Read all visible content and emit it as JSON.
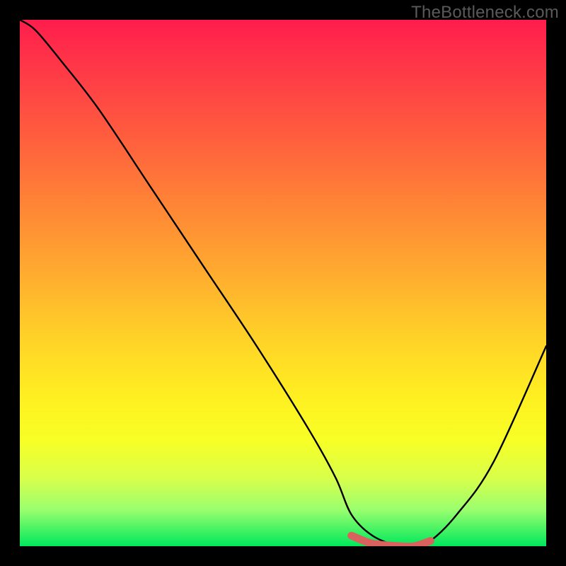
{
  "watermark": "TheBottleneck.com",
  "chart_data": {
    "type": "line",
    "title": "",
    "xlabel": "",
    "ylabel": "",
    "xlim": [
      0,
      100
    ],
    "ylim": [
      0,
      100
    ],
    "series": [
      {
        "name": "bottleneck-curve",
        "x": [
          0,
          3,
          8,
          15,
          25,
          35,
          45,
          55,
          60,
          63,
          67,
          72,
          75,
          78,
          83,
          90,
          100
        ],
        "y": [
          100,
          98,
          92,
          83,
          68,
          53,
          38,
          22,
          13,
          6,
          2,
          0,
          0,
          1,
          6,
          16,
          38
        ],
        "color": "#000000"
      },
      {
        "name": "optimal-range-marker",
        "x": [
          63,
          67,
          72,
          75,
          78
        ],
        "y": [
          2,
          0.5,
          0,
          0,
          1
        ],
        "color": "#d9625f"
      }
    ],
    "gradient_stops": [
      {
        "pos": 0,
        "color": "#ff1d4c"
      },
      {
        "pos": 50,
        "color": "#ffc02a"
      },
      {
        "pos": 80,
        "color": "#f7ff26"
      },
      {
        "pos": 100,
        "color": "#00e85c"
      }
    ]
  }
}
